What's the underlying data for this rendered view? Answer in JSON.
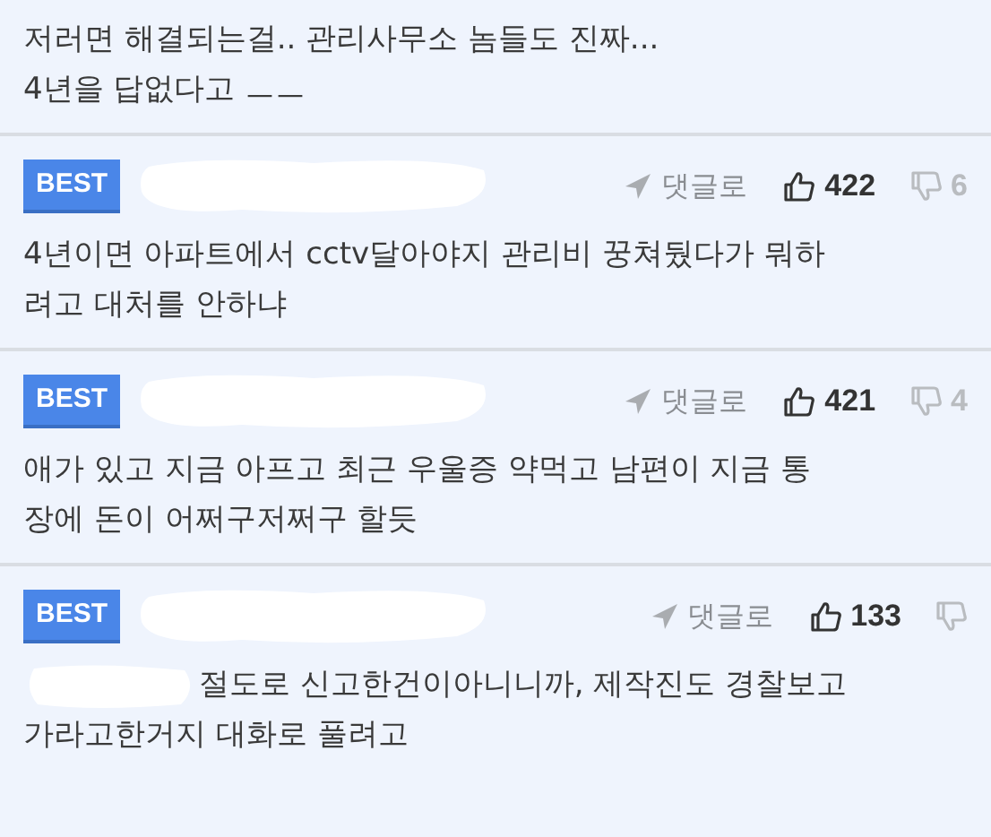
{
  "comments": [
    {
      "kind": "tail",
      "lines": [
        "저러면 해결되는걸.. 관리사무소 놈들도 진짜...",
        "4년을 답없다고 ㅡㅡ"
      ]
    },
    {
      "kind": "full",
      "badge": "BEST",
      "reply_label": "댓글로",
      "likes": "422",
      "dislikes": "6",
      "redacted_prefix": false,
      "lines": [
        "4년이면 아파트에서 cctv달아야지 관리비 꿍쳐뒀다가 뭐하",
        "려고 대처를 안하냐"
      ]
    },
    {
      "kind": "full",
      "badge": "BEST",
      "reply_label": "댓글로",
      "likes": "421",
      "dislikes": "4",
      "redacted_prefix": false,
      "lines": [
        "애가 있고 지금 아프고 최근 우울증 약먹고 남편이 지금 통",
        "장에 돈이 어쩌구저쩌구 할듯"
      ]
    },
    {
      "kind": "full",
      "badge": "BEST",
      "reply_label": "댓글로",
      "likes": "133",
      "redacted_prefix": true,
      "lines": [
        "절도로 신고한건이아니니까, 제작진도 경찰보고",
        "가라고한거지 대화로 풀려고"
      ]
    }
  ]
}
